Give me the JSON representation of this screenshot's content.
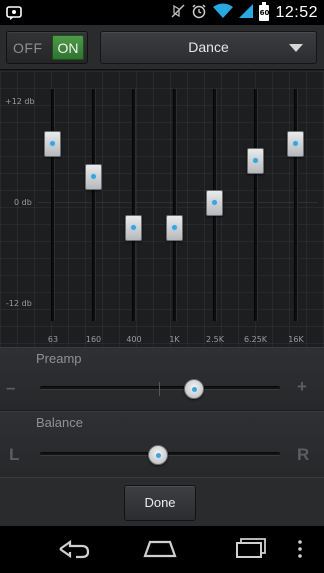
{
  "status_bar": {
    "time": "12:52",
    "battery_level": "60",
    "icons": [
      "notification-icon",
      "mute-icon",
      "alarm-icon",
      "wifi-icon",
      "signal-icon",
      "battery-icon"
    ]
  },
  "toggle": {
    "off_label": "OFF",
    "on_label": "ON",
    "state": "on",
    "on_color": "#3f8a3c"
  },
  "preset": {
    "selected": "Dance"
  },
  "eq": {
    "db_labels": {
      "top": "+12 db",
      "mid": "0 db",
      "bottom": "-12 db"
    },
    "range_db": [
      -12,
      12
    ],
    "bands": [
      {
        "freq": "63",
        "gain_db": 7
      },
      {
        "freq": "160",
        "gain_db": 3
      },
      {
        "freq": "400",
        "gain_db": -3
      },
      {
        "freq": "1K",
        "gain_db": -3
      },
      {
        "freq": "2.5K",
        "gain_db": 0
      },
      {
        "freq": "6.25K",
        "gain_db": 5
      },
      {
        "freq": "16K",
        "gain_db": 7
      }
    ]
  },
  "preamp": {
    "label": "Preamp",
    "minus": "–",
    "plus": "+",
    "value": 0.64
  },
  "balance": {
    "label": "Balance",
    "left": "L",
    "right": "R",
    "value": 0.49
  },
  "done_label": "Done",
  "nav": {
    "icons": [
      "back-icon",
      "home-icon",
      "recent-apps-icon",
      "menu-icon"
    ]
  },
  "accent_color": "#3ba3e0"
}
